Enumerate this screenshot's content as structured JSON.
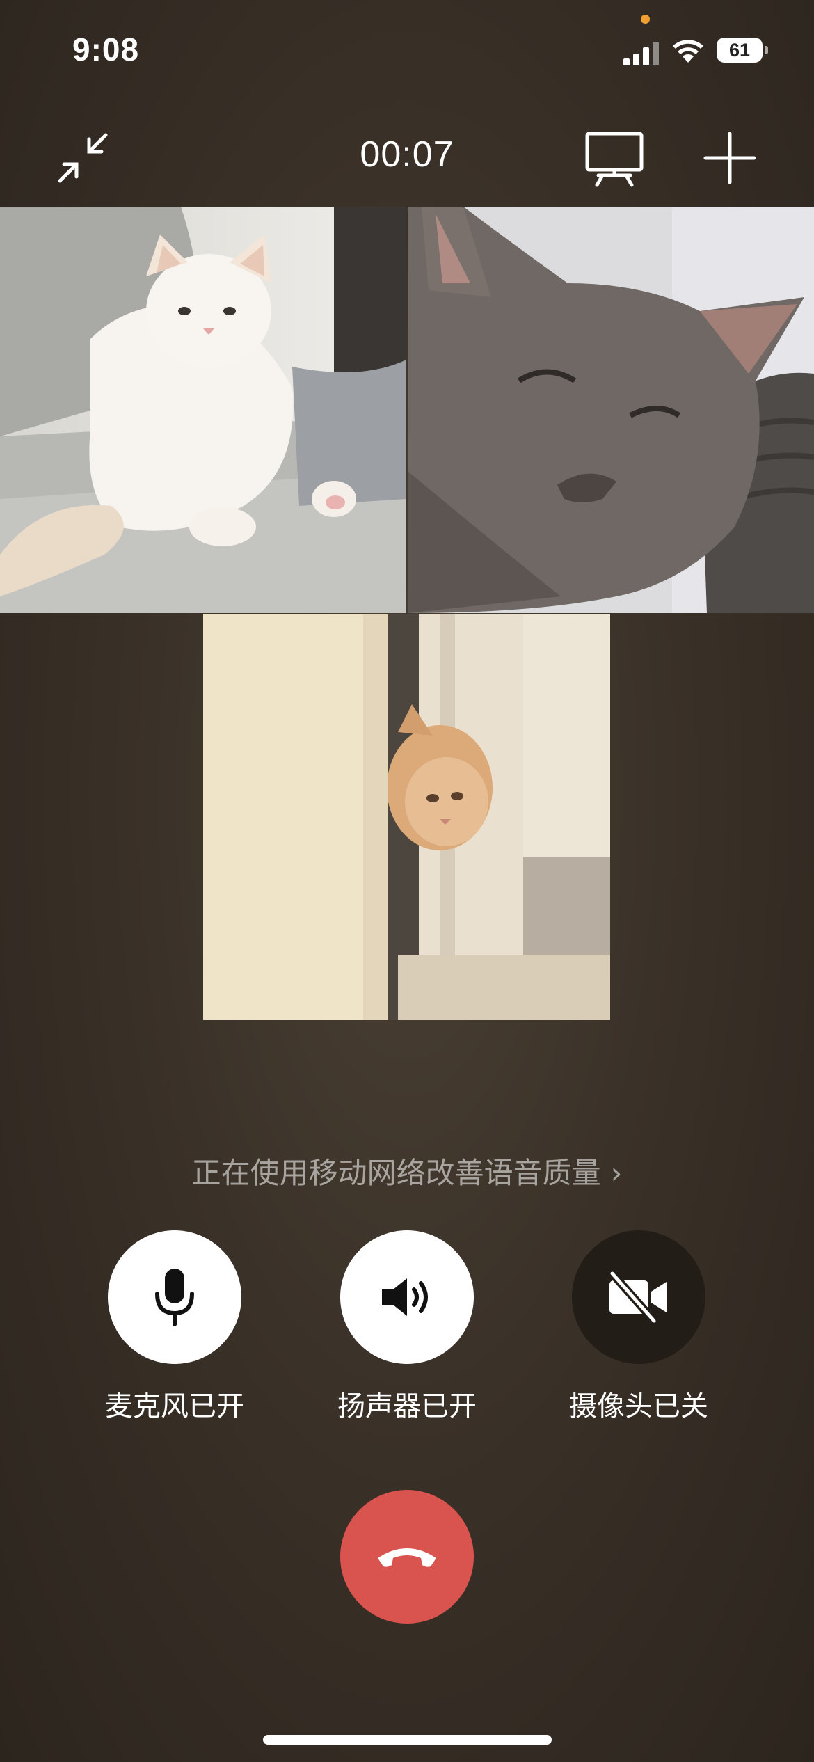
{
  "status_bar": {
    "time": "9:08",
    "battery": "61",
    "signal_icon": "cellular-signal-icon",
    "wifi_icon": "wifi-icon",
    "indicator_color": "#f0a030"
  },
  "top_bar": {
    "timer": "00:07",
    "minimize_icon": "minimize-icon",
    "screen_share_icon": "screen-share-icon",
    "add_icon": "add-participant-icon"
  },
  "participants": [
    {
      "video_icon": "participant-video"
    },
    {
      "video_icon": "participant-video"
    },
    {
      "video_icon": "participant-video"
    }
  ],
  "notice": {
    "text": "正在使用移动网络改善语音质量",
    "chevron": "›"
  },
  "controls": {
    "mic": {
      "label": "麦克风已开",
      "state": "on",
      "icon": "microphone-icon"
    },
    "speaker": {
      "label": "扬声器已开",
      "state": "on",
      "icon": "speaker-icon"
    },
    "camera": {
      "label": "摄像头已关",
      "state": "off",
      "icon": "camera-off-icon"
    },
    "hangup": {
      "icon": "hang-up-icon",
      "color": "#d9534f"
    }
  }
}
